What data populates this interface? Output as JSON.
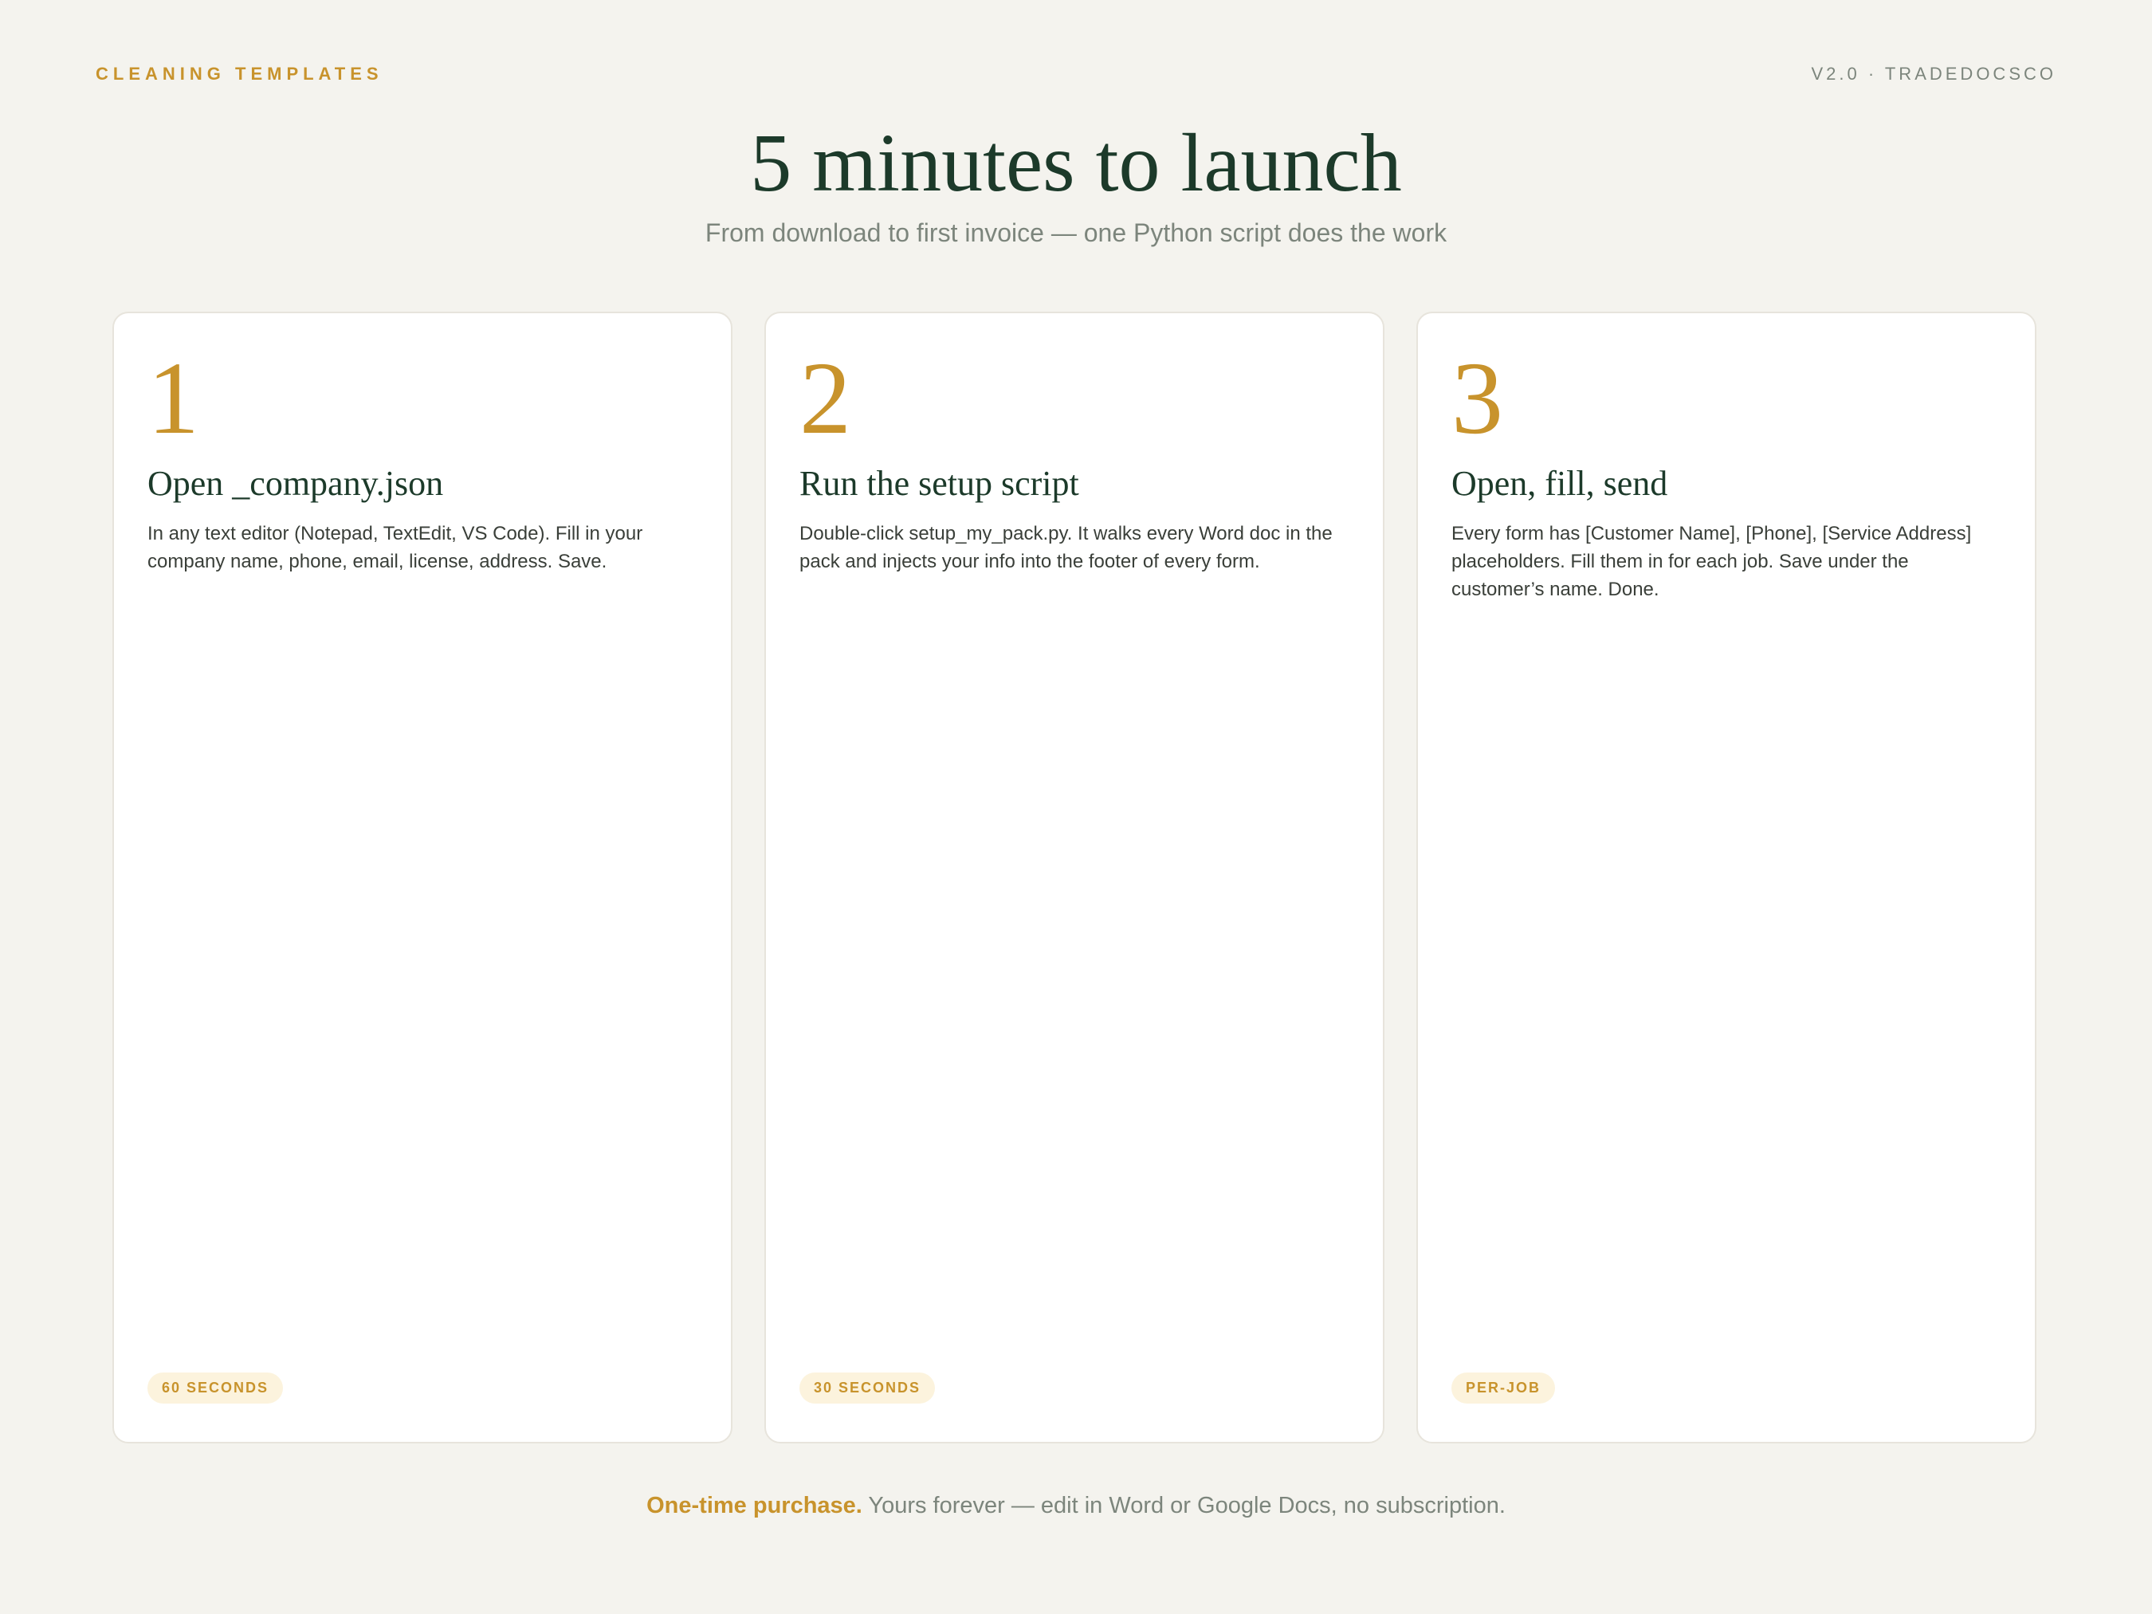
{
  "header": {
    "category": "CLEANING TEMPLATES",
    "version": "V2.0 · TRADEDOCSCO"
  },
  "hero": {
    "title": "5 minutes to launch",
    "subtitle": "From download to first invoice — one Python script does the work"
  },
  "steps": [
    {
      "number": "1",
      "title": "Open _company.json",
      "body": "In any text editor (Notepad, TextEdit, VS Code). Fill in your company name, phone, email, license, address. Save.",
      "badge": "60 SECONDS"
    },
    {
      "number": "2",
      "title": "Run the setup script",
      "body": "Double-click setup_my_pack.py. It walks every Word doc in the pack and injects your info into the footer of every form.",
      "badge": "30 SECONDS"
    },
    {
      "number": "3",
      "title": "Open, fill, send",
      "body": "Every form has [Customer Name], [Phone], [Service Address] placeholders. Fill them in for each job. Save under the customer’s name. Done.",
      "badge": "PER-JOB"
    }
  ],
  "footer": {
    "highlight": "One-time purchase.",
    "text": " Yours forever — edit in Word or Google Docs, no subscription."
  },
  "colors": {
    "background": "#f4f3ee",
    "accent": "#c8932c",
    "heading": "#1c3a2a",
    "muted": "#7c857c"
  }
}
